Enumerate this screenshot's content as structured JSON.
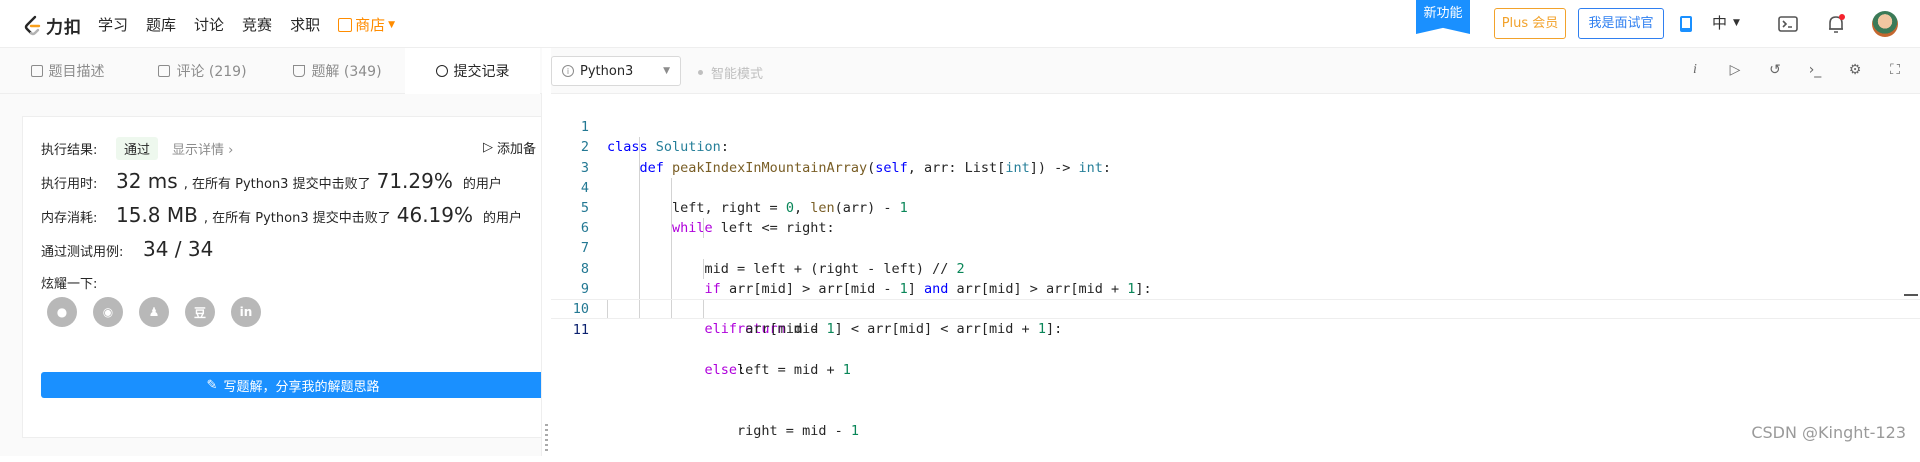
{
  "topnav": {
    "logo_text": "力扣",
    "items": [
      "学习",
      "题库",
      "讨论",
      "竞赛",
      "求职"
    ],
    "shop_label": "商店",
    "new_feature": "新功能",
    "plus_label": "Plus 会员",
    "interviewer_label": "我是面试官",
    "lang_label": "中"
  },
  "tabs": [
    {
      "label": "题目描述",
      "icon": "document-icon"
    },
    {
      "label": "评论 (219)",
      "icon": "comment-icon"
    },
    {
      "label": "题解 (349)",
      "icon": "flask-icon"
    },
    {
      "label": "提交记录",
      "icon": "clock-icon"
    }
  ],
  "result": {
    "result_label": "执行结果:",
    "status": "通过",
    "detail_link": "显示详情 ›",
    "add_note": "添加备",
    "time_label": "执行用时:",
    "time_value": "32 ms",
    "time_text": ", 在所有 Python3 提交中击败了",
    "time_pct": "71.29%",
    "time_suffix": "的用户",
    "mem_label": "内存消耗:",
    "mem_value": "15.8 MB",
    "mem_text": ", 在所有 Python3 提交中击败了",
    "mem_pct": "46.19%",
    "mem_suffix": "的用户",
    "tests_label": "通过测试用例:",
    "tests_value": "34 / 34",
    "share_label": "炫耀一下:",
    "share_icons": [
      "wechat-icon",
      "weibo-icon",
      "qq-icon",
      "douban-icon",
      "linkedin-icon"
    ],
    "write_button": "写题解，分享我的解题思路"
  },
  "editor": {
    "language": "Python3",
    "smart_mode": "智能模式",
    "tools": [
      "info-icon",
      "run-icon",
      "reset-icon",
      "console-icon",
      "settings-icon",
      "fullscreen-icon"
    ],
    "line_numbers": [
      "1",
      "2",
      "3",
      "4",
      "5",
      "6",
      "7",
      "8",
      "9",
      "10",
      "11"
    ]
  },
  "watermark": "CSDN @Kinght-123"
}
